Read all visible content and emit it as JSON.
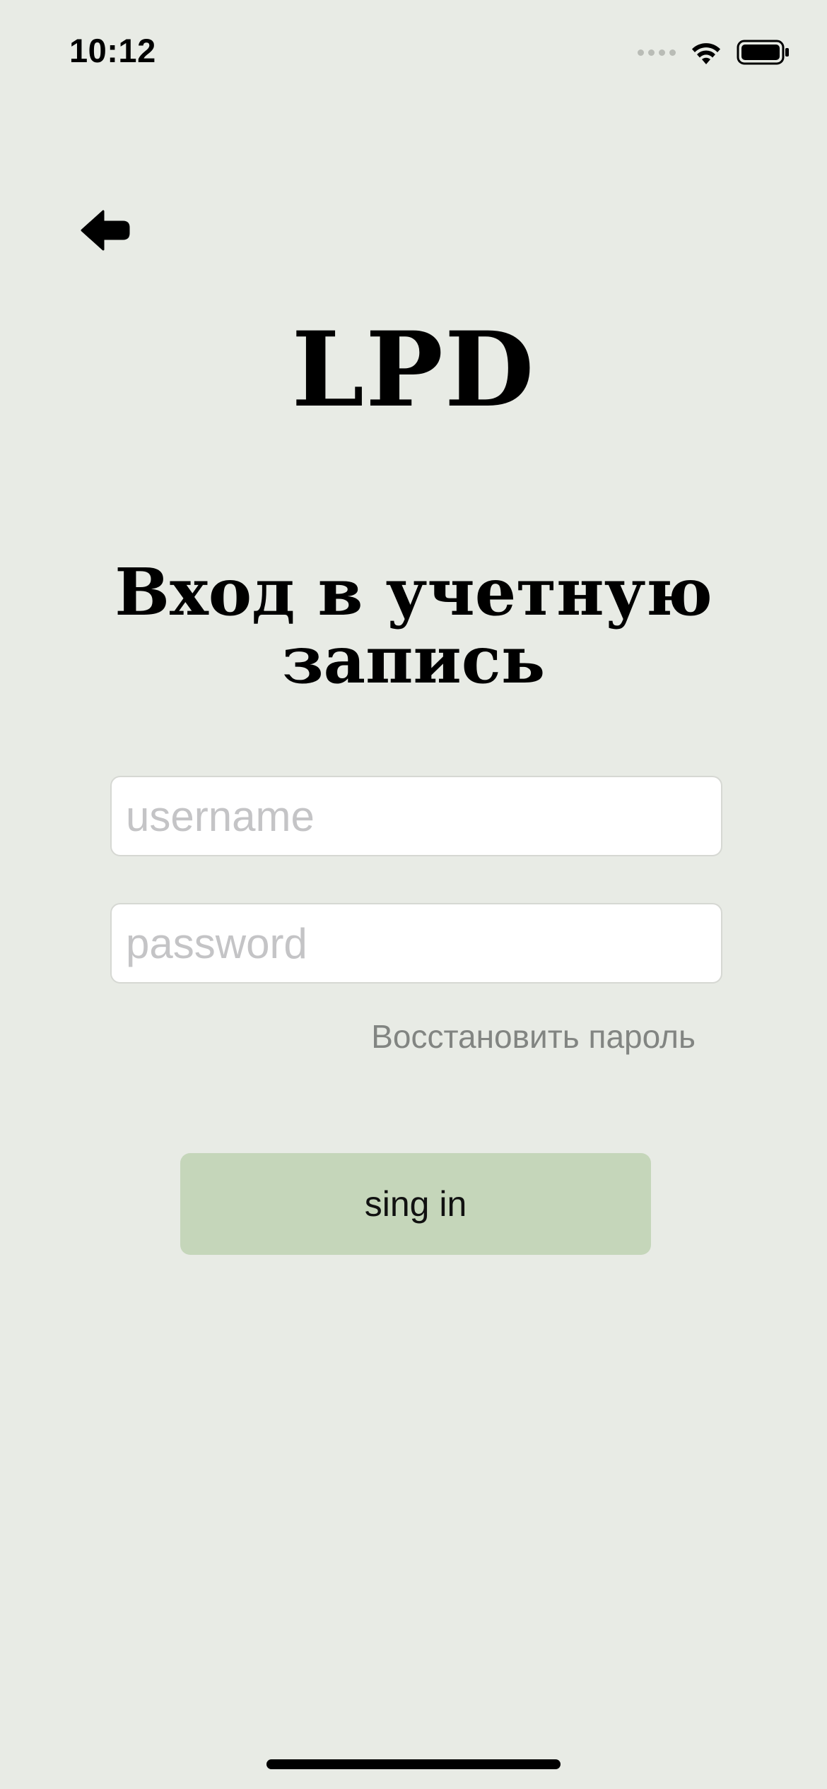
{
  "status_bar": {
    "time": "10:12"
  },
  "navigation": {
    "back_icon": "back-arrow-icon"
  },
  "app": {
    "logo": "LPD"
  },
  "login": {
    "heading_line1": "Вход в учетную",
    "heading_line2": "запись",
    "username_placeholder": "username",
    "username_value": "",
    "password_placeholder": "password",
    "password_value": "",
    "forgot_password": "Восстановить пароль",
    "submit_label": "sing in"
  },
  "colors": {
    "background": "#e8ebe5",
    "button": "#c5d6ba",
    "link": "#828582",
    "placeholder": "#c4c4c6"
  }
}
